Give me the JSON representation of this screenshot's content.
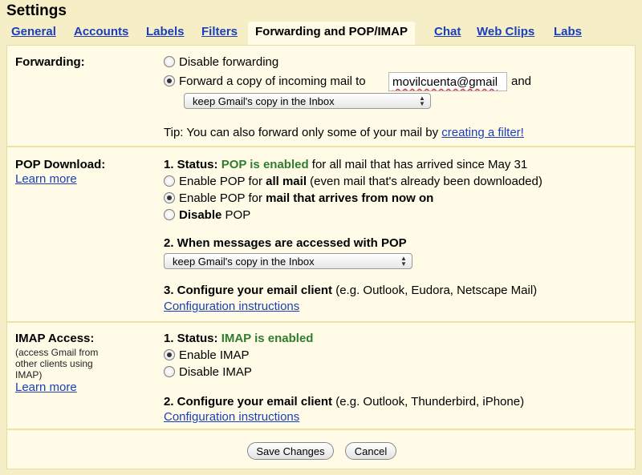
{
  "page_title": "Settings",
  "tabs": [
    {
      "label": "General"
    },
    {
      "label": "Accounts"
    },
    {
      "label": "Labels"
    },
    {
      "label": "Filters"
    },
    {
      "label": "Forwarding and POP/IMAP"
    },
    {
      "label": "Chat"
    },
    {
      "label": "Web Clips"
    },
    {
      "label": "Labs"
    }
  ],
  "forwarding": {
    "label": "Forwarding:",
    "disable_label": "Disable forwarding",
    "forward_label": "Forward a copy of incoming mail to",
    "email_value": "movilcuenta@gmail",
    "and_text": "and",
    "select_value": "keep Gmail's copy in the Inbox",
    "tip_text": "Tip: You can also forward only some of your mail by",
    "tip_link": "creating a filter!"
  },
  "pop": {
    "label": "POP Download:",
    "learn_more": "Learn more",
    "status_prefix": "1. Status:",
    "status_value": "POP is enabled",
    "status_suffix": "for all mail that has arrived since May 31",
    "opt1_pre": "Enable POP for",
    "opt1_bold": "all mail",
    "opt1_post": "(even mail that's already been downloaded)",
    "opt2_pre": "Enable POP for",
    "opt2_bold": "mail that arrives from now on",
    "opt3_bold": "Disable",
    "opt3_post": "POP",
    "step2": "2. When messages are accessed with POP",
    "select_value": "keep Gmail's copy in the Inbox",
    "step3_bold": "3. Configure your email client",
    "step3_rest": "(e.g. Outlook, Eudora, Netscape Mail)",
    "config_link": "Configuration instructions"
  },
  "imap": {
    "label": "IMAP Access:",
    "sub1": "(access Gmail from",
    "sub2": "other clients using",
    "sub3": "IMAP)",
    "learn_more": "Learn more",
    "status_prefix": "1. Status:",
    "status_value": "IMAP is enabled",
    "enable_label": "Enable IMAP",
    "disable_label": "Disable IMAP",
    "step2_bold": "2. Configure your email client",
    "step2_rest": "(e.g. Outlook, Thunderbird, iPhone)",
    "config_link": "Configuration instructions"
  },
  "buttons": {
    "save": "Save Changes",
    "cancel": "Cancel"
  }
}
